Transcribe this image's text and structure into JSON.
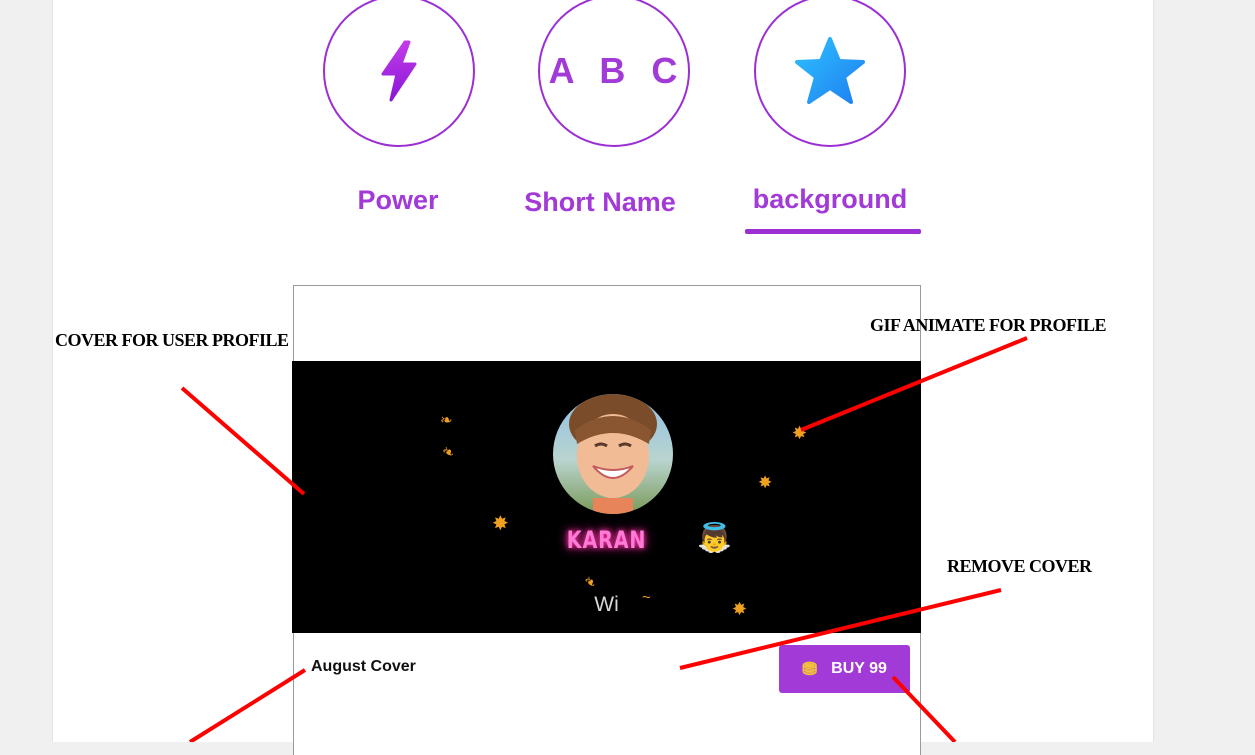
{
  "tabs": [
    {
      "label": "Power",
      "icon": "lightning-bolt-icon"
    },
    {
      "label": "Short Name",
      "icon_text": "A B C"
    },
    {
      "label": "background",
      "icon": "star-icon",
      "active": true
    }
  ],
  "cover": {
    "username": "KARAN",
    "subtext": "Wi",
    "name": "August Cover",
    "buy_label": "BUY 99",
    "buy_icon": "coin-icon"
  },
  "annotations": {
    "cover_for_user_profile": "COVER FOR USER PROFILE",
    "gif_animate": "GIF ANIMATE FOR PROFILE",
    "remove_cover": "REMOVE COVER"
  },
  "colors": {
    "accent": "#9b2fd4",
    "label": "#a23ad8",
    "annotation_arrow": "#ff0000",
    "cover_bg": "#000000"
  }
}
